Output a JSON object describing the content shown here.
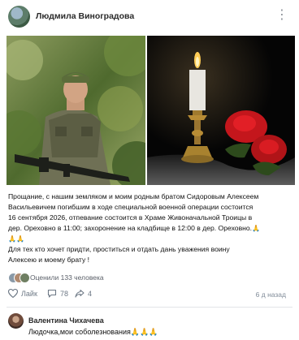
{
  "post": {
    "author": "Людмила Виноградова",
    "text_lines": [
      "Прощание, с нашим земляком и моим родным братом Сидоровым Алексеем",
      "Васильевичем погибшим в ходе специальной военной операции состоится",
      "16 сентября 2026, отпевание состоится в Храме Живоначальной Троицы в",
      "дер. Ореховно в 11:00; захоронение на кладбище в 12:00 в дер. Ореховно."
    ],
    "emoji_inline": "🙏",
    "emoji_line2": "🙏🙏",
    "text_lines_b": [
      "Для тех кто хочет придти, проститься и отдать дань уважения воину",
      "Алексею и моему брату !"
    ],
    "rated_label": "Оценили 133 человека",
    "like_label": "Лайк",
    "comments_count": "78",
    "shares_count": "4",
    "time_ago": "6 д назад"
  },
  "comment": {
    "author": "Валентина Чихачева",
    "text": "Людочка,мои соболезнования🙏🙏🙏"
  },
  "icons": {
    "more": "more-dots-icon",
    "like": "heart-icon",
    "comment": "comment-icon",
    "share": "share-icon"
  },
  "colors": {
    "accent": "#2a5885",
    "muted": "#818c99",
    "background": "#ffffff"
  }
}
